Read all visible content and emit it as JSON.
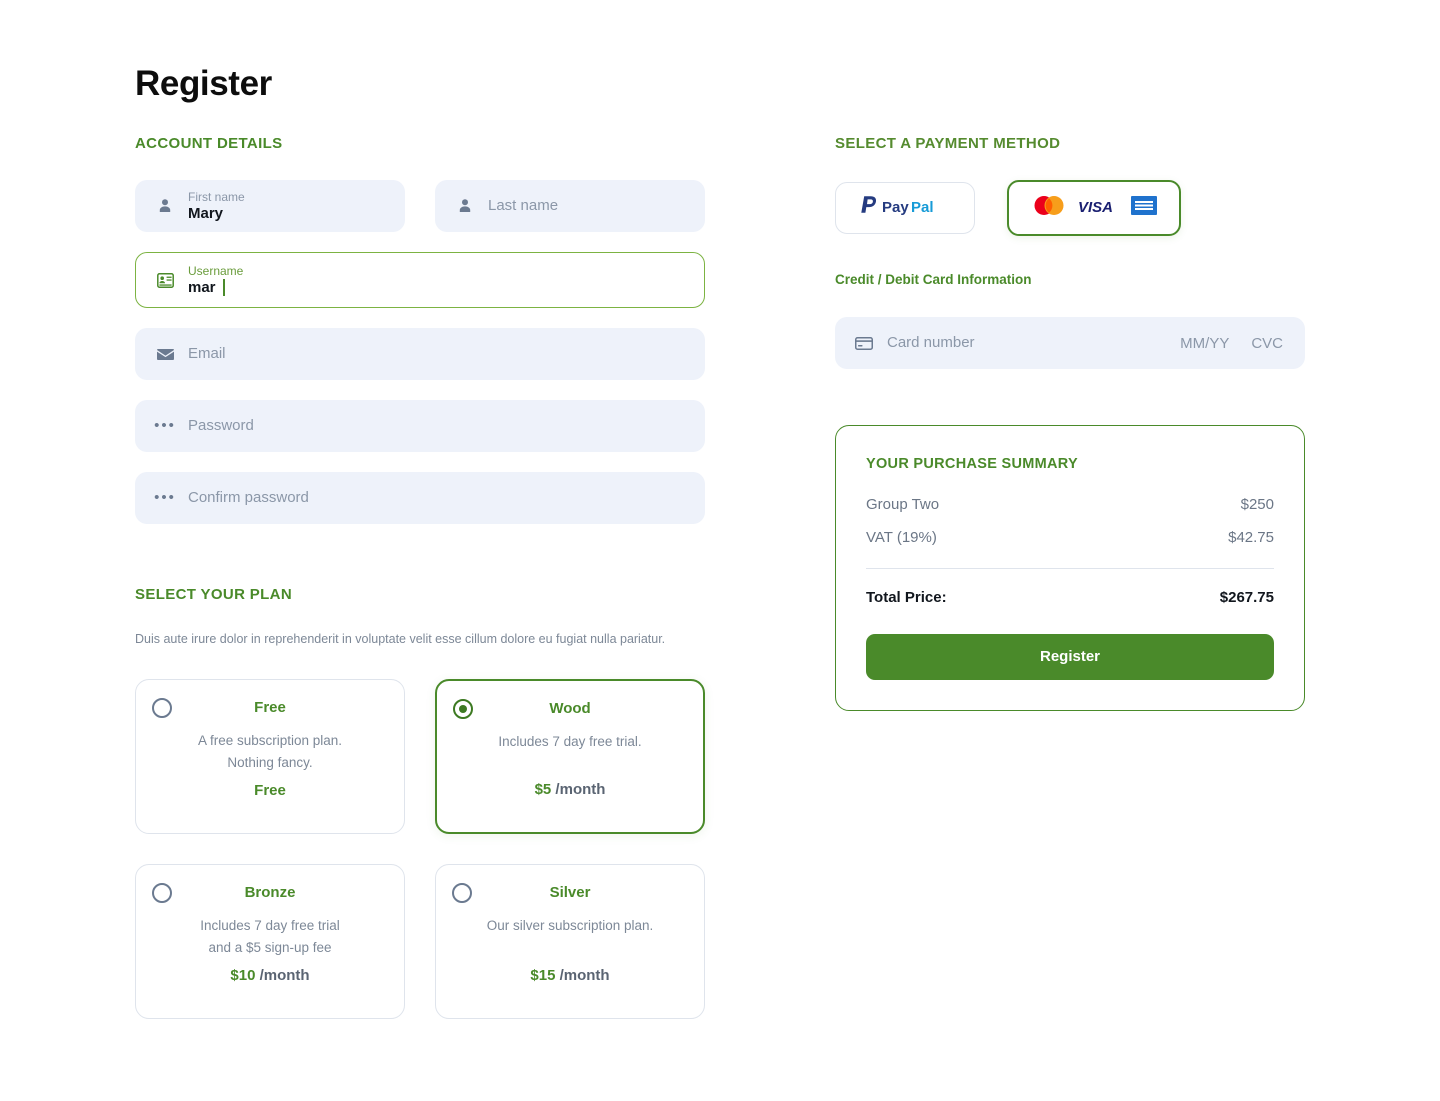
{
  "page": {
    "title": "Register"
  },
  "account": {
    "heading": "ACCOUNT DETAILS",
    "first_name": {
      "label": "First name",
      "value": "Mary",
      "icon": "person-icon"
    },
    "last_name": {
      "placeholder": "Last name",
      "icon": "person-icon"
    },
    "username": {
      "label": "Username",
      "value": "mar",
      "icon": "contact-card-icon"
    },
    "email": {
      "placeholder": "Email",
      "icon": "envelope-icon"
    },
    "password": {
      "placeholder": "Password",
      "icon": "dots-icon"
    },
    "confirm_password": {
      "placeholder": "Confirm password",
      "icon": "dots-icon"
    }
  },
  "plan": {
    "heading": "SELECT YOUR PLAN",
    "description": "Duis aute irure dolor in reprehenderit in voluptate velit esse cillum dolore eu fugiat nulla pariatur.",
    "options": [
      {
        "name": "Free",
        "detail_line1": "A free subscription plan.",
        "detail_line2": "Nothing fancy.",
        "price_amount": "Free",
        "price_per": "",
        "selected": false
      },
      {
        "name": "Wood",
        "detail_line1": "Includes 7 day free trial.",
        "detail_line2": "",
        "price_amount": "$5",
        "price_per": " /month",
        "selected": true
      },
      {
        "name": "Bronze",
        "detail_line1": "Includes 7 day free trial",
        "detail_line2": "and a $5 sign-up fee",
        "price_amount": "$10",
        "price_per": " /month",
        "selected": false
      },
      {
        "name": "Silver",
        "detail_line1": "Our silver subscription plan.",
        "detail_line2": "",
        "price_amount": "$15",
        "price_per": " /month",
        "selected": false
      }
    ]
  },
  "payment": {
    "heading": "SELECT A PAYMENT METHOD",
    "methods": [
      {
        "id": "paypal",
        "label": "PayPal",
        "selected": false
      },
      {
        "id": "credit-card",
        "label": "Mastercard Visa American Express",
        "selected": true
      }
    ],
    "card_info_label": "Credit / Debit Card Information",
    "card_number_placeholder": "Card number",
    "expiry_placeholder": "MM/YY",
    "cvc_placeholder": "CVC"
  },
  "summary": {
    "title": "YOUR PURCHASE SUMMARY",
    "lines": [
      {
        "label": "Group Two",
        "value": "$250"
      },
      {
        "label": "VAT (19%)",
        "value": "$42.75"
      }
    ],
    "total_label": "Total Price:",
    "total_value": "$267.75",
    "register_button": "Register"
  },
  "colors": {
    "accent_green": "#4a8a2a",
    "field_bg": "#eef2fa",
    "muted_text": "#8b97a8",
    "border": "#dfe4ec"
  }
}
